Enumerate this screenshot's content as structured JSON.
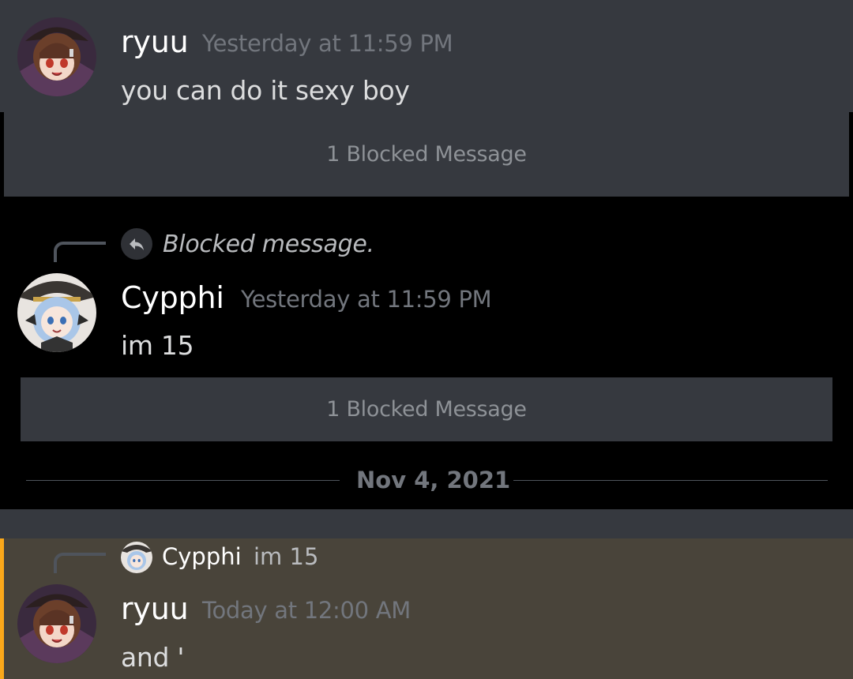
{
  "messages": [
    {
      "username": "ryuu",
      "timestamp": "Yesterday at 11:59 PM",
      "text": "you can do it sexy boy",
      "avatar": "red-hair-witch-avatar"
    },
    {
      "username": "Cypphi",
      "timestamp": "Yesterday at 11:59 PM",
      "text": "im 15",
      "avatar": "blue-hair-witch-avatar",
      "reply": {
        "text": "Blocked message.",
        "icon": "reply-arrow-icon"
      }
    },
    {
      "username": "ryuu",
      "timestamp": "Today at 12:00 AM",
      "text": "and '",
      "avatar": "red-hair-witch-avatar",
      "reply": {
        "username": "Cypphi",
        "snippet": "im 15"
      }
    }
  ],
  "blocked_groups": [
    {
      "label": "1 Blocked Message"
    },
    {
      "label": "1 Blocked Message"
    }
  ],
  "date_divider": "Nov 4, 2021",
  "colors": {
    "background": "#000000",
    "message_bg": "#36393f",
    "mention_bg": "#49443a",
    "mention_bar": "#faa81a",
    "username": "#ffffff",
    "timestamp": "#72767d",
    "text": "#dcddde"
  }
}
